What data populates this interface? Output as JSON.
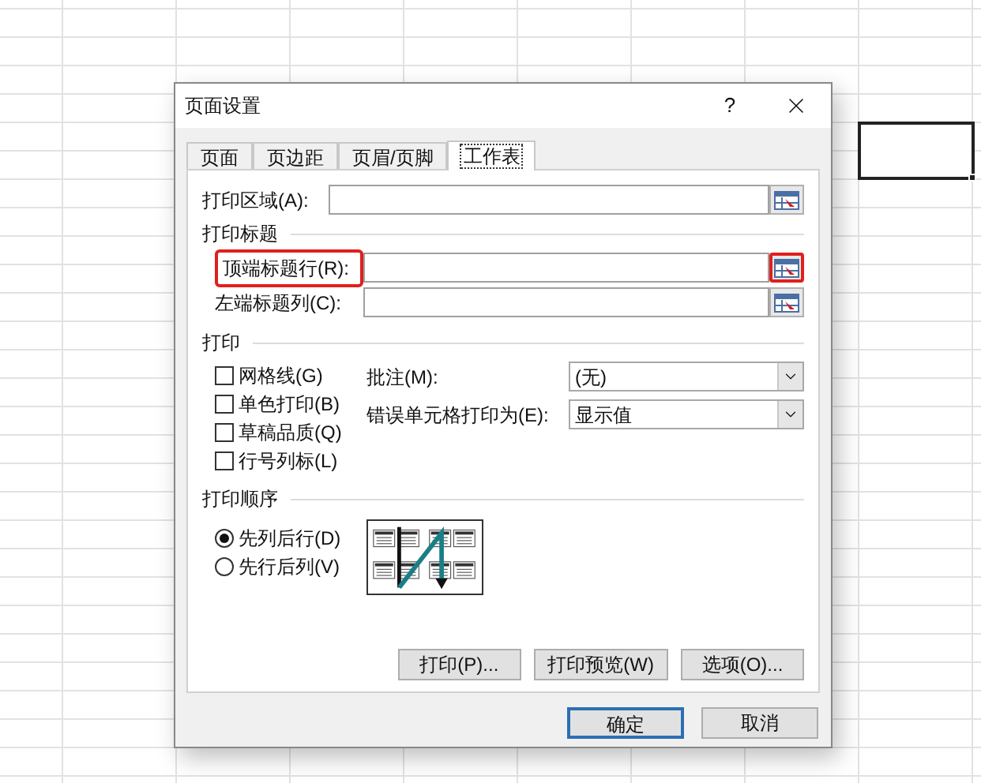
{
  "window": {
    "title": "页面设置",
    "help": "?"
  },
  "tabs": [
    {
      "label": "页面",
      "selected": false
    },
    {
      "label": "页边距",
      "selected": false
    },
    {
      "label": "页眉/页脚",
      "selected": false
    },
    {
      "label": "工作表",
      "selected": true
    }
  ],
  "print_area": {
    "label": "打印区域(A):",
    "highlighted": false
  },
  "print_titles": {
    "heading": "打印标题",
    "fields": [
      {
        "label": "顶端标题行(R):",
        "highlighted": true
      },
      {
        "label": "左端标题列(C):",
        "highlighted": false
      }
    ]
  },
  "print": {
    "heading": "打印",
    "options": [
      {
        "label": "网格线(G)",
        "checked": false
      },
      {
        "label": "单色打印(B)",
        "checked": false
      },
      {
        "label": "草稿品质(Q)",
        "checked": false
      },
      {
        "label": "行号列标(L)",
        "checked": false
      }
    ],
    "selects": [
      {
        "label": "批注(M):",
        "value": "(无)"
      },
      {
        "label": "错误单元格打印为(E):",
        "value": "显示值"
      }
    ]
  },
  "page_order": {
    "heading": "打印顺序",
    "options": [
      {
        "label": "先列后行(D)",
        "selected": true
      },
      {
        "label": "先行后列(V)",
        "selected": false
      }
    ]
  },
  "action_buttons": [
    "打印(P)...",
    "打印预览(W)",
    "选项(O)..."
  ],
  "dialog_buttons": [
    {
      "label": "确定",
      "default": true
    },
    {
      "label": "取消",
      "default": false
    }
  ]
}
